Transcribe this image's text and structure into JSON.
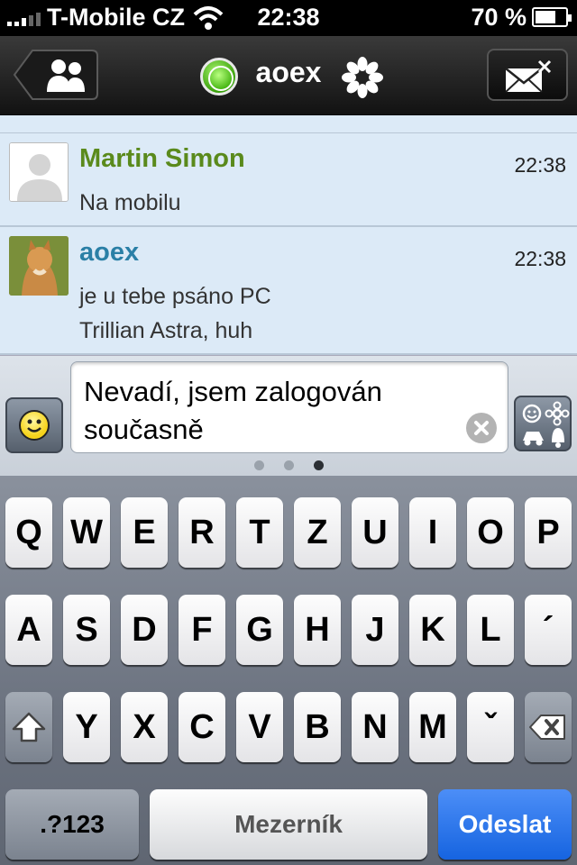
{
  "status_bar": {
    "carrier": "T-Mobile CZ",
    "time": "22:38",
    "battery_percent": "70 %",
    "battery_level": 0.7,
    "signal_icon": "signal-bars-icon",
    "wifi_icon": "wifi-icon"
  },
  "nav": {
    "title": "aoex",
    "back_icon": "contacts-icon",
    "status_icon": "online-status-icon",
    "network_icon": "icq-flower-icon",
    "close_chat_icon": "close-mail-icon"
  },
  "messages": [
    {
      "sender": "Martin Simon",
      "time": "22:38",
      "lines": [
        "Na mobilu"
      ],
      "name_color": "#5a8a1c"
    },
    {
      "sender": "aoex",
      "time": "22:38",
      "lines": [
        "je u tebe psáno PC",
        "Trillian Astra, huh"
      ],
      "name_color": "#2a7fa6"
    }
  ],
  "composer": {
    "value": "Nevadí, jsem zalogován současně",
    "emoticon_icon": "smiley-icon",
    "clear_icon": "clear-icon",
    "emoji_picker_icon": "emoji-categories-icon",
    "page_count": 3,
    "active_page": 3
  },
  "keyboard": {
    "row1": [
      "Q",
      "W",
      "E",
      "R",
      "T",
      "Z",
      "U",
      "I",
      "O",
      "P"
    ],
    "row2": [
      "A",
      "S",
      "D",
      "F",
      "G",
      "H",
      "J",
      "K",
      "L",
      "´"
    ],
    "row3": [
      "Y",
      "X",
      "C",
      "V",
      "B",
      "N",
      "M",
      "ˇ"
    ],
    "shift_icon": "shift-icon",
    "delete_icon": "backspace-icon",
    "numbers_label": ".?123",
    "space_label": "Mezerník",
    "send_label": "Odeslat"
  }
}
